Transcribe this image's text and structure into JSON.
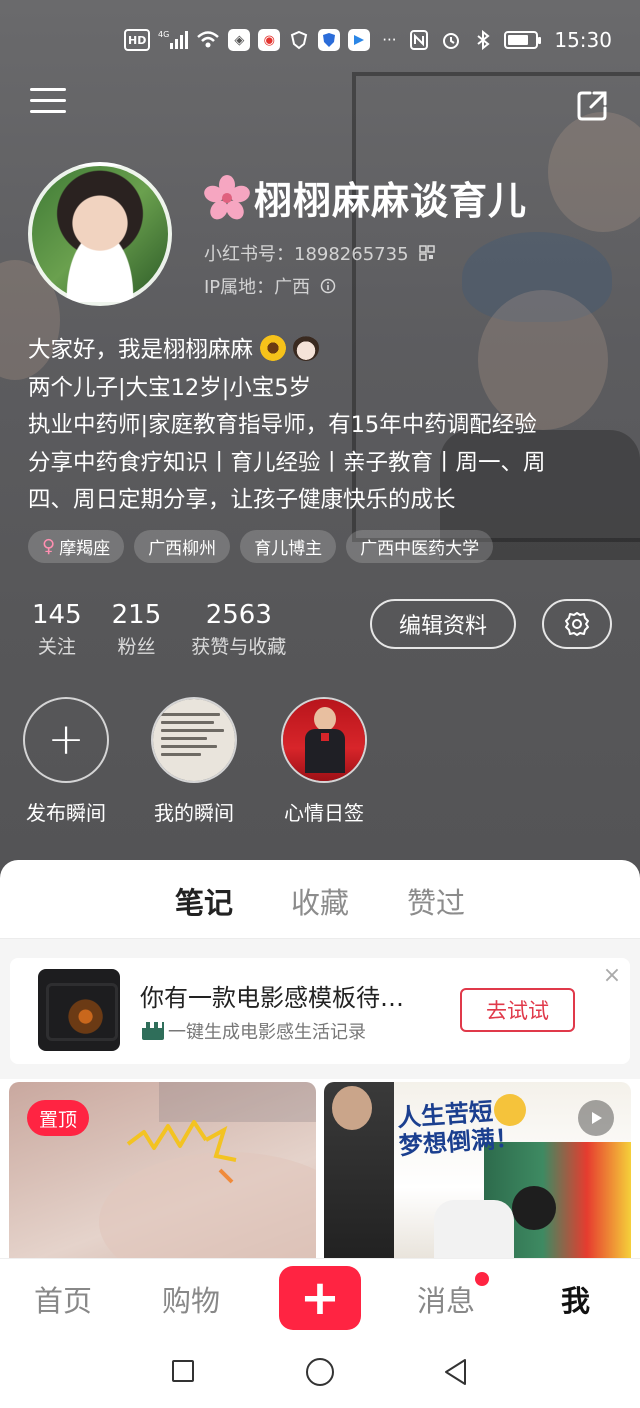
{
  "status_bar": {
    "hd": "HD",
    "network": "4G",
    "time": "15:30",
    "more": "···",
    "battery_level": 0.75
  },
  "profile": {
    "nickname": "栩栩麻麻谈育儿",
    "redbook_id": "小红书号：1898265735",
    "ip_location": "IP属地：广西",
    "bio": [
      "大家好，我是栩栩麻麻",
      "两个儿子|大宝12岁|小宝5岁",
      "执业中药师|家庭教育指导师，有15年中药调配经验",
      "分享中药食疗知识丨育儿经验丨亲子教育丨周一、周",
      "四、周日定期分享，让孩子健康快乐的成长"
    ],
    "tags": [
      "摩羯座",
      "广西柳州",
      "育儿博主",
      "广西中医药大学"
    ],
    "stats": [
      {
        "value": "145",
        "label": "关注"
      },
      {
        "value": "215",
        "label": "粉丝"
      },
      {
        "value": "2563",
        "label": "获赞与收藏"
      }
    ],
    "edit_button": "编辑资料",
    "moments": [
      {
        "label": "发布瞬间"
      },
      {
        "label": "我的瞬间"
      },
      {
        "label": "心情日签"
      }
    ]
  },
  "content_tabs": [
    "笔记",
    "收藏",
    "赞过"
  ],
  "active_tab": "笔记",
  "promo": {
    "title": "你有一款电影感模板待…",
    "subtitle": "一键生成电影感生活记录",
    "button": "去试试"
  },
  "notes": {
    "pinned_label": "置顶",
    "right_card_title": [
      "人生苦短",
      "梦想倒满！"
    ]
  },
  "bottom_nav": {
    "home": "首页",
    "shopping": "购物",
    "add": "+",
    "messages": "消息",
    "me": "我"
  },
  "colors": {
    "brand": "#ff2442",
    "header_bg": "#5c5c5f"
  }
}
